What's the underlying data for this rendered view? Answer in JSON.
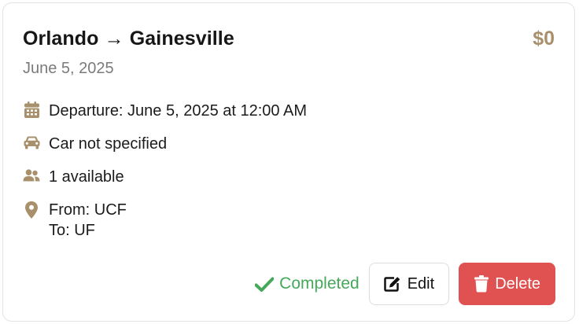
{
  "ride": {
    "title": "Orlando → Gainesville",
    "price": "$0",
    "date": "June 5, 2025",
    "departure": "Departure: June 5, 2025 at 12:00 AM",
    "car": "Car not specified",
    "seats": "1 available",
    "from": "From: UCF",
    "to": "To: UF"
  },
  "actions": {
    "status": "Completed",
    "edit_label": "Edit",
    "delete_label": "Delete"
  },
  "icons": {
    "departure": "calendar-icon",
    "car": "car-icon",
    "seats": "users-icon",
    "route": "map-pin-icon",
    "status": "checkmark-icon",
    "edit": "edit-icon",
    "delete": "trash-icon"
  },
  "colors": {
    "accent": "#a9906c",
    "success": "#45a85a",
    "danger": "#e05252",
    "muted": "#7b7b7b"
  }
}
